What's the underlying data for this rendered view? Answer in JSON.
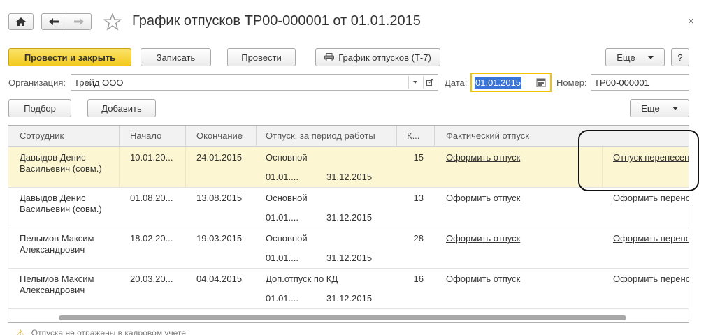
{
  "window": {
    "title": "График отпусков ТР00-000001 от 01.01.2015",
    "close_glyph": "×"
  },
  "toolbar": {
    "post_and_close": "Провести и закрыть",
    "save": "Записать",
    "post": "Провести",
    "print_schedule": "График отпусков (Т-7)",
    "more": "Еще",
    "help": "?"
  },
  "form": {
    "organization_label": "Организация:",
    "organization_value": "Трейд ООО",
    "date_label": "Дата:",
    "date_value": "01.01.2015",
    "number_label": "Номер:",
    "number_value": "ТР00-000001"
  },
  "table_toolbar": {
    "pick": "Подбор",
    "add": "Добавить",
    "more": "Еще"
  },
  "table": {
    "columns": {
      "employee": "Сотрудник",
      "start": "Начало",
      "end": "Окончание",
      "vacation_period": "Отпуск, за период работы",
      "days": "К...",
      "actual": "Фактический отпуск"
    },
    "rows": [
      {
        "employee_line1": "Давыдов Денис",
        "employee_line2": "Васильевич (совм.)",
        "start": "10.01.20...",
        "end": "24.01.2015",
        "vacation_type": "Основной",
        "period_from": "01.01....",
        "period_to": "31.12.2015",
        "days": "15",
        "actual_link": "Оформить отпуск",
        "transfer_link": "Отпуск перенесен"
      },
      {
        "employee_line1": "Давыдов Денис",
        "employee_line2": "Васильевич (совм.)",
        "start": "01.08.20...",
        "end": "13.08.2015",
        "vacation_type": "Основной",
        "period_from": "01.01....",
        "period_to": "31.12.2015",
        "days": "13",
        "actual_link": "Оформить отпуск",
        "transfer_link": "Оформить перенос"
      },
      {
        "employee_line1": "Пелымов Максим",
        "employee_line2": "Александрович",
        "start": "18.02.20...",
        "end": "19.03.2015",
        "vacation_type": "Основной",
        "period_from": "01.01....",
        "period_to": "31.12.2015",
        "days": "28",
        "actual_link": "Оформить отпуск",
        "transfer_link": "Оформить перенос"
      },
      {
        "employee_line1": "Пелымов Максим",
        "employee_line2": "Александрович",
        "start": "20.03.20...",
        "end": "04.04.2015",
        "vacation_type": "Доп.отпуск по КД",
        "period_from": "01.01....",
        "period_to": "31.12.2015",
        "days": "16",
        "actual_link": "Оформить отпуск",
        "transfer_link": "Оформить перенос"
      }
    ]
  },
  "footer": {
    "warning_glyph": "⚠",
    "text": "Отпуска не отражены в кадровом учете"
  }
}
